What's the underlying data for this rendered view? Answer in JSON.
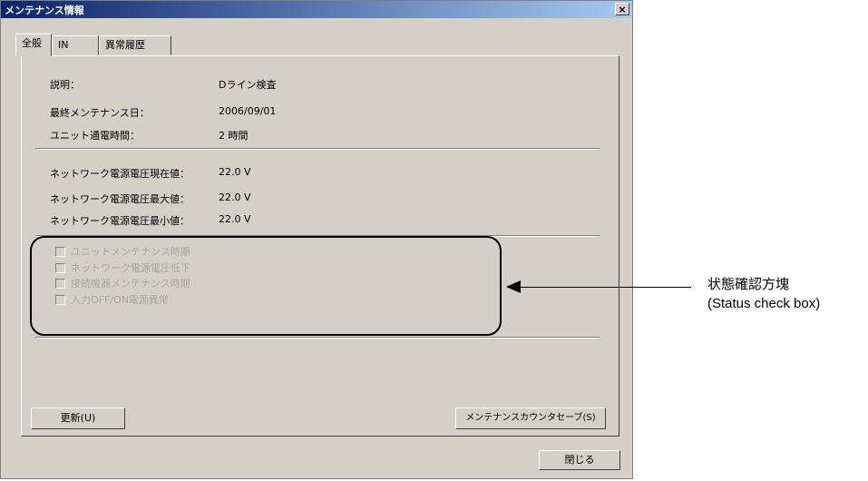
{
  "window": {
    "title": "メンテナンス情報",
    "close_glyph": "×"
  },
  "tabs": [
    {
      "label": "全般"
    },
    {
      "label": "IN"
    },
    {
      "label": "異常履歴"
    }
  ],
  "info": [
    {
      "label": "説明：",
      "value": "Dライン検査"
    },
    {
      "label": "最終メンテナンス日：",
      "value": "2006/09/01"
    },
    {
      "label": "ユニット通電時間：",
      "value": "2 時間"
    }
  ],
  "network": [
    {
      "label": "ネットワーク電源電圧現在値：",
      "value": "22.0 V"
    },
    {
      "label": "ネットワーク電源電圧最大値：",
      "value": "22.0 V"
    },
    {
      "label": "ネットワーク電源電圧最小値：",
      "value": "22.0 V"
    }
  ],
  "status_checks": [
    {
      "label": "ユニットメンテナンス時期"
    },
    {
      "label": "ネットワーク電源電圧低下"
    },
    {
      "label": "接続機器メンテナンス時期"
    },
    {
      "label": "入力OFF/ON電源異常"
    }
  ],
  "buttons": {
    "refresh": "更新(U)",
    "save_counter": "メンテナンスカウンタセーブ(S)",
    "close": "閉じる"
  },
  "annotation": {
    "line1": "状態確認方塊",
    "line2": "(Status check box)"
  }
}
